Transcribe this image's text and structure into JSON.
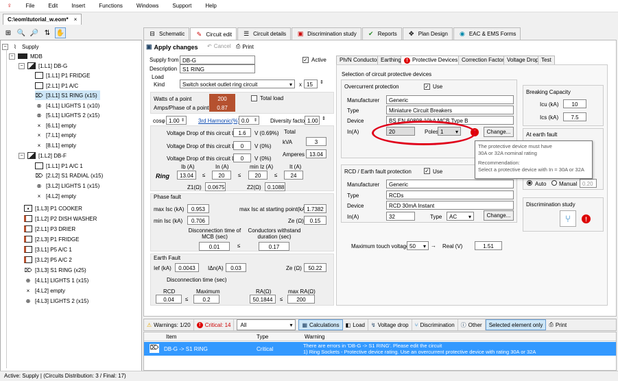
{
  "menu": [
    "File",
    "Edit",
    "Insert",
    "Functions",
    "Windows",
    "Support",
    "Help"
  ],
  "document_tab": "C:\\eom\\tutorial_w.eom*",
  "tree": {
    "items": [
      {
        "label": "Supply",
        "level": 0
      },
      {
        "label": "MDB",
        "level": 1
      },
      {
        "label": "[1.L1] DB-G",
        "level": 2
      },
      {
        "label": "[1.L1] P1 FRIDGE",
        "level": 3
      },
      {
        "label": "[2.L1] P1 A/C",
        "level": 3
      },
      {
        "label": "[3.L1] S1 RING (x15)",
        "level": 3
      },
      {
        "label": "[4.L1] LIGHTS 1 (x10)",
        "level": 3
      },
      {
        "label": "[5.L1] LIGHTS 2 (x15)",
        "level": 3
      },
      {
        "label": "[6.L1] empty",
        "level": 3
      },
      {
        "label": "[7.L1] empty",
        "level": 3
      },
      {
        "label": "[8.L1] empty",
        "level": 3
      },
      {
        "label": "[1.L2] DB-F",
        "level": 2
      },
      {
        "label": "[1.L1] P1 A/C 1",
        "level": 3
      },
      {
        "label": "[2.L2] S1 RADIAL (x15)",
        "level": 3
      },
      {
        "label": "[3.L2] LIGHTS 1 (x15)",
        "level": 3
      },
      {
        "label": "[4.L2] empty",
        "level": 3
      },
      {
        "label": "[1.L3] P1 COOKER",
        "level": 2
      },
      {
        "label": "[1.L2] P2 DISH WASHER",
        "level": 2
      },
      {
        "label": "[2.L1] P3 DRIER",
        "level": 2
      },
      {
        "label": "[2.L3] P1 FRIDGE",
        "level": 2
      },
      {
        "label": "[3.L1] P5 A/C 1",
        "level": 2
      },
      {
        "label": "[3.L2] P5 A/C 2",
        "level": 2
      },
      {
        "label": "[3.L3] S1 RING (x25)",
        "level": 2
      },
      {
        "label": "[4.L1] LIGHTS 1 (x15)",
        "level": 2
      },
      {
        "label": "[4.L2] empty",
        "level": 2
      },
      {
        "label": "[4.L3] LIGHTS 2 (x15)",
        "level": 2
      }
    ]
  },
  "main_tabs": [
    "Schematic",
    "Circuit edit",
    "Circuit details",
    "Discrimination study",
    "Reports",
    "Plan Design",
    "EAC & EMS Forms"
  ],
  "actions": {
    "apply": "Apply changes",
    "cancel": "Cancel",
    "print": "Print"
  },
  "form": {
    "supply_from_label": "Supply from",
    "supply_from": "DB-G",
    "description_label": "Description",
    "description": "S1 RING",
    "active_label": "Active",
    "load_label": "Load",
    "kind_label": "Kind",
    "kind": "Switch socket outlet ring circuit",
    "x": "x",
    "kind_count": "15",
    "watts_label": "Watts of a point",
    "watts": "200",
    "amps_label": "Amps/Phase of a point",
    "amps": "0.87",
    "total_load": "Total load",
    "cosphi_label": "cosφ",
    "cosphi": "1.00",
    "harmonic": "3rd Harmonic(%)",
    "harmonic_val": "0.0",
    "diversity_label": "Diversity factor",
    "diversity": "1.00",
    "vd_l1_label": "Voltage Drop of this circuit L1",
    "vd_l1": "1.6",
    "vd_l1_pct": "V (0.69%)",
    "vd_l2_label": "Voltage Drop of this circuit L2",
    "vd_l2": "0",
    "vd_l2_pct": "V (0%)",
    "vd_l3_label": "Voltage Drop of this circuit L3",
    "vd_l3": "0",
    "vd_l3_pct": "V (0%)",
    "total_label": "Total",
    "kva_label": "kVA",
    "kva": "3",
    "amperes_label": "Amperes",
    "amperes": "13.04",
    "ring_label": "Ring",
    "ib_label": "Ib (A)",
    "ib": "13.04",
    "in_label": "In (A)",
    "in": "20",
    "minz_label": "min Iz (A)",
    "minz": "20",
    "it_label": "It (A)",
    "it": "24",
    "le": "≤",
    "z1_label": "Z1(Ω)",
    "z1": "0.0675",
    "z2_label": "Z2(Ω)",
    "z2": "0.1088",
    "phase_fault": "Phase fault",
    "maxisc_label": "max Isc (kA)",
    "maxisc": "0.953",
    "maxisc_start_label": "max Isc at starting point(kA)",
    "maxisc_start": "1.7382",
    "minisc_label": "min Isc (kA)",
    "minisc": "0.706",
    "ze_label": "Ze (Ω)",
    "ze": "0.15",
    "disc_label": "Disconnection time of MCB (sec)",
    "disc": "0.01",
    "cond_label": "Conductors withstand duration (sec)",
    "cond": "0.17",
    "earth_fault": "Earth Fault",
    "ief_label": "Ief (kA)",
    "ief": "0.0043",
    "idn_label": "IΔn(A)",
    "idn": "0.03",
    "ze2_label": "Ze (Ω)",
    "ze2": "50.22",
    "disc_time_label": "Disconnection time (sec)",
    "rcd_label": "RCD",
    "rcd": "0.04",
    "maximum_label": "Maximum",
    "maximum": "0.2",
    "ra_label": "RA(Ω)",
    "ra": "50.1844",
    "maxra_label": "max RA(Ω)",
    "maxra": "200"
  },
  "sub_tabs": [
    "Ph/N Conductor",
    "Earthing",
    "Protective Devices",
    "Correction Factors",
    "Voltage Drop",
    "Test"
  ],
  "protective": {
    "selection_label": "Selection of circuit protective devices",
    "oc_label": "Overcurrent protection",
    "use": "Use",
    "manufacturer_label": "Manufacturer",
    "manufacturer": "Generic",
    "type_label": "Type",
    "type": "Miniature Circuit Breakers",
    "device_label": "Device",
    "device": "BS EN 60898 10kA MCB Type B",
    "in_label": "In(A)",
    "in": "20",
    "poles_label": "Poles",
    "poles": "1",
    "change": "Change...",
    "rcd_section": "RCD / Earth fault protection",
    "rcd_manufacturer": "Generic",
    "rcd_type": "RCDs",
    "rcd_device": "RCD 30mA Instant",
    "rcd_in": "32",
    "rcd_type2_label": "Type",
    "rcd_type2": "AC",
    "touch_label": "Maximum touch voltage",
    "touch": "50",
    "real_label": "Real (V)",
    "real": "1.51",
    "breaking_label": "Breaking Capacity",
    "icu_label": "Icu (kA)",
    "icu": "10",
    "ics_label": "Ics (kA)",
    "ics": "7.5",
    "earth_fault_label": "At earth fault",
    "auto": "Auto",
    "manual": "Manual",
    "manual_val": "0.20",
    "disc_study": "Discrimination study"
  },
  "tooltip": {
    "line1": "The protective device must have",
    "line2": "30A or 32A nominal rating",
    "line3": "Recommendation:",
    "line4": "Select a protective device with In = 30A or 32A"
  },
  "bottom": {
    "warnings": "Warnings: 1/20",
    "critical": "Critical: 14",
    "filter": "All",
    "calculations": "Calculations",
    "load": "Load",
    "vdrop": "Voltage drop",
    "discrimination": "Discrimination",
    "other": "Other",
    "selected_only": "Selected element only",
    "print": "Print"
  },
  "grid": {
    "headers": [
      "Item",
      "Type",
      "Warning"
    ],
    "row": {
      "item": "DB-G -> S1 RING",
      "type": "Critical",
      "w1": "There are errors in 'DB-G -> S1 RING'. Please edit the circuit",
      "w2": "1) Ring Sockets - Protective device rating. Use an overcurrent protective device with rating 30A or 32A"
    }
  },
  "status": "Active: Supply | (Circuits Distribution: 3 / Final: 17)",
  "colors": {
    "accent": "#0078d7",
    "value_red": "#b5512f",
    "highlight": "#3399ff",
    "alert": "#d00000"
  }
}
